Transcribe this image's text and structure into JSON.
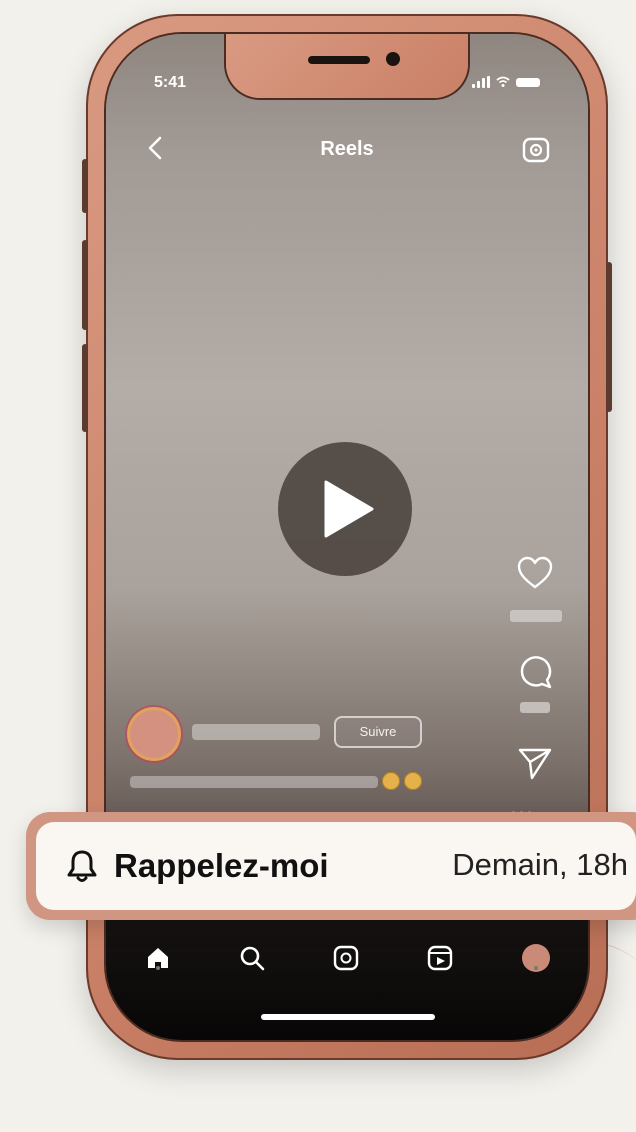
{
  "status_bar": {
    "time": "5:41"
  },
  "header": {
    "title": "Reels"
  },
  "post": {
    "follow_label": "Suivre"
  },
  "reminder": {
    "label": "Rappelez-moi",
    "time": "Demain, 18h"
  },
  "icons": {
    "back": "back-arrow-icon",
    "camera": "camera-icon",
    "play": "play-icon",
    "like": "heart-icon",
    "comment": "comment-icon",
    "share": "send-icon",
    "more": "more-icon",
    "bell": "bell-icon",
    "home": "home-icon",
    "search": "search-icon",
    "create": "create-icon",
    "reels": "reels-icon",
    "profile": "profile-avatar-icon"
  },
  "colors": {
    "frame": "#c98066",
    "reminder_background": "#faf6f2",
    "tab_bar": "#080606"
  }
}
